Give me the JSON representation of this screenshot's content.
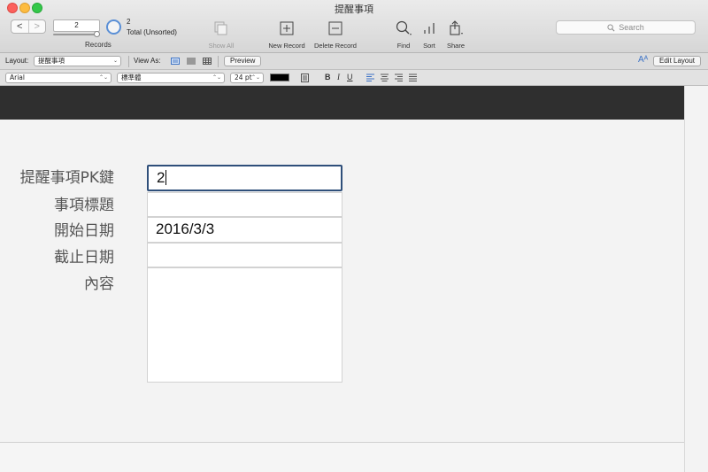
{
  "window": {
    "title": "提醒事項"
  },
  "toolbar": {
    "back": "<",
    "forward": ">",
    "record_number": "2",
    "records_label": "Records",
    "found_count": "2",
    "total_text": "Total (Unsorted)",
    "show_all": "Show All",
    "new_record": "New Record",
    "delete_record": "Delete Record",
    "find": "Find",
    "sort": "Sort",
    "share": "Share",
    "search_placeholder": "Search"
  },
  "layout_bar": {
    "layout_label": "Layout:",
    "layout_value": "提醒事項",
    "view_as_label": "View As:",
    "preview": "Preview",
    "edit_layout": "Edit Layout",
    "aa": "Aᴬ"
  },
  "format_bar": {
    "font": "Arial",
    "style": "標準體",
    "size": "24 pt",
    "bold": "B",
    "italic": "I",
    "underline": "U"
  },
  "form": {
    "fields": [
      {
        "label": "提醒事項PK鍵",
        "value": "2"
      },
      {
        "label": "事項標題",
        "value": ""
      },
      {
        "label": "開始日期",
        "value": "2016/3/3"
      },
      {
        "label": "截止日期",
        "value": ""
      },
      {
        "label": "內容",
        "value": ""
      }
    ]
  },
  "colors": {
    "header_part": "#2f2f2f",
    "active_field_border": "#2f4f7a",
    "pie_ring": "#5a8fd6"
  }
}
